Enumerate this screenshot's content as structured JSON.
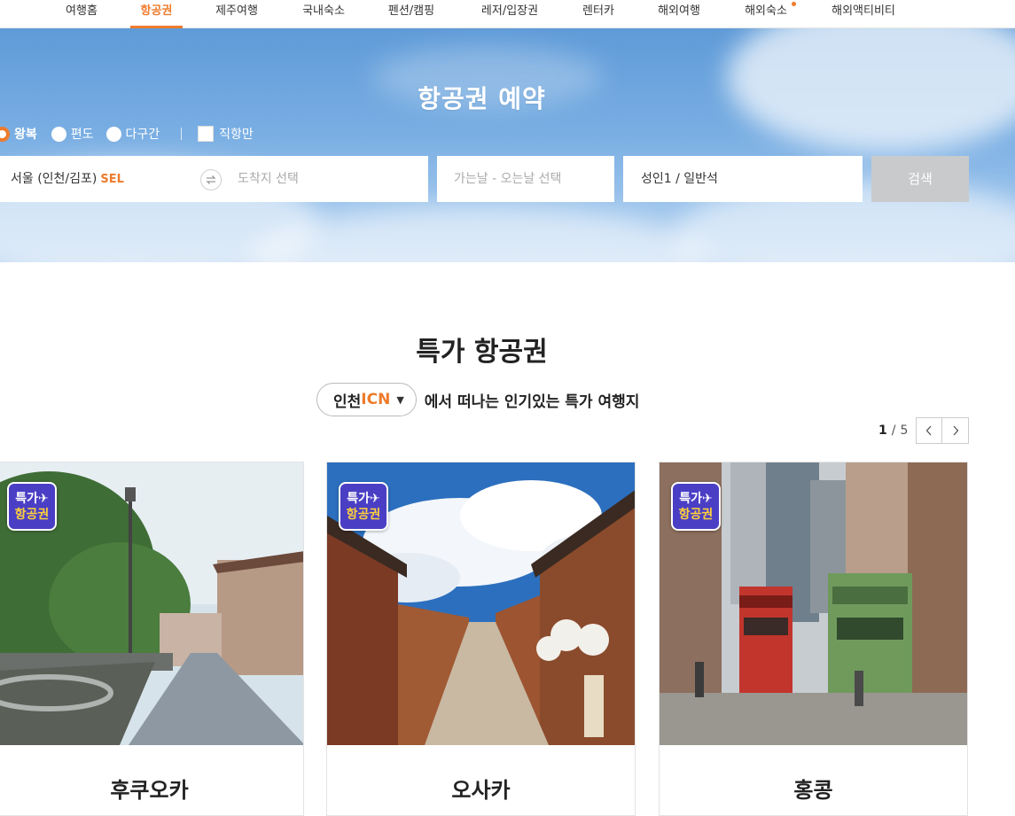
{
  "nav": {
    "items": [
      {
        "label": "여행홈"
      },
      {
        "label": "항공권"
      },
      {
        "label": "제주여행"
      },
      {
        "label": "국내숙소"
      },
      {
        "label": "펜션/캠핑"
      },
      {
        "label": "레저/입장권"
      },
      {
        "label": "렌터카"
      },
      {
        "label": "해외여행"
      },
      {
        "label": "해외숙소"
      },
      {
        "label": "해외액티비티"
      }
    ],
    "active_label": "항공권"
  },
  "hero": {
    "title": "항공권 예약",
    "trip_types": {
      "round": "왕복",
      "oneway": "편도",
      "multi": "다구간",
      "selected": "왕복"
    },
    "direct_only": {
      "label": "직항만",
      "checked": false
    },
    "origin": {
      "city": "서울 (인천/김포)",
      "code": "SEL"
    },
    "destination": {
      "placeholder": "도착지 선택"
    },
    "dates": {
      "placeholder": "가는날 - 오는날 선택"
    },
    "passengers": {
      "value": "성인1 / 일반석"
    },
    "search_label": "검색"
  },
  "deals": {
    "title": "특가 항공권",
    "origin": {
      "city": "인천",
      "code": "ICN"
    },
    "subtitle": "에서 떠나는 인기있는 특가 여행지",
    "pager": {
      "current": "1",
      "total": "5"
    },
    "badge": {
      "line1": "특가✈",
      "line2": "항공권"
    },
    "cards": [
      {
        "name": "후쿠오카"
      },
      {
        "name": "오사카"
      },
      {
        "name": "홍콩"
      }
    ]
  },
  "colors": {
    "accent": "#ee7b2c",
    "sky": "#79aee3",
    "button_disabled": "#c9cacc",
    "badge": "#4a3fc4"
  },
  "icons": [
    "swap-icon",
    "chevron-left-icon",
    "chevron-right-icon",
    "caret-down-icon",
    "airplane-icon"
  ]
}
